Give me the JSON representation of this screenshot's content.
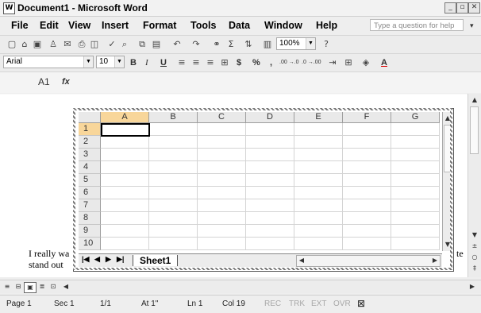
{
  "window": {
    "title": "Document1 - Microsoft Word",
    "icon": "word-doc-icon"
  },
  "menu": [
    "File",
    "Edit",
    "View",
    "Insert",
    "Format",
    "Tools",
    "Data",
    "Window",
    "Help"
  ],
  "help_placeholder": "Type a question for help",
  "toolbar": {
    "zoom": "100%"
  },
  "format_toolbar": {
    "font": "Arial",
    "size": "10",
    "bold": "B",
    "italic": "I",
    "underline": "U",
    "currency": "$",
    "percent": "%",
    "comma": ",",
    "inc_decimal": ".00 →.0",
    "dec_decimal": ".0 →.00"
  },
  "formula_bar": {
    "name_box": "A1",
    "fx": "fx"
  },
  "spreadsheet": {
    "columns": [
      "A",
      "B",
      "C",
      "D",
      "E",
      "F",
      "G"
    ],
    "rows": [
      "1",
      "2",
      "3",
      "4",
      "5",
      "6",
      "7",
      "8",
      "9",
      "10"
    ],
    "active_cell": "A1",
    "sheet_tab": "Sheet1"
  },
  "document": {
    "line1_start": "I really wa",
    "line1_end": "te",
    "line2_start": "stand out"
  },
  "status": {
    "page": "Page 1",
    "sec": "Sec 1",
    "pages": "1/1",
    "at": "At 1\"",
    "ln": "Ln 1",
    "col": "Col 19",
    "rec": "REC",
    "trk": "TRK",
    "ext": "EXT",
    "ovr": "OVR"
  }
}
